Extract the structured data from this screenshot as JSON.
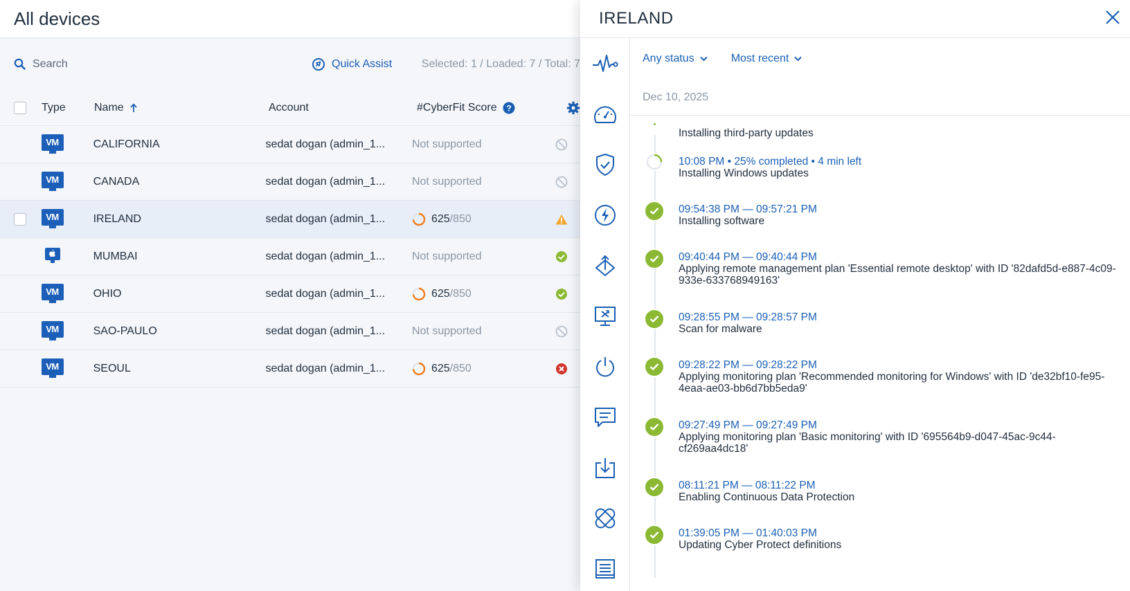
{
  "list": {
    "title": "All devices",
    "search_placeholder": "Search",
    "quick_assist": "Quick Assist",
    "counts": "Selected: 1 / Loaded: 7 / Total: 7",
    "columns": {
      "type": "Type",
      "name": "Name",
      "account": "Account",
      "cyberfit": "#CyberFit Score"
    },
    "rows": [
      {
        "name": "CALIFORNIA",
        "type": "VM",
        "account": "sedat dogan (admin_1...",
        "score": "Not supported",
        "score_max": "",
        "status": "not-protected"
      },
      {
        "name": "CANADA",
        "type": "VM",
        "account": "sedat dogan (admin_1...",
        "score": "Not supported",
        "score_max": "",
        "status": "not-protected"
      },
      {
        "name": "IRELAND",
        "type": "VM",
        "account": "sedat dogan (admin_1...",
        "score": "625",
        "score_max": "/850",
        "status": "warning"
      },
      {
        "name": "MUMBAI",
        "type": "Mac",
        "account": "sedat dogan (admin_1...",
        "score": "Not supported",
        "score_max": "",
        "status": "ok"
      },
      {
        "name": "OHIO",
        "type": "VM",
        "account": "sedat dogan (admin_1...",
        "score": "625",
        "score_max": "/850",
        "status": "ok"
      },
      {
        "name": "SAO-PAULO",
        "type": "VM",
        "account": "sedat dogan (admin_1...",
        "score": "Not supported",
        "score_max": "",
        "status": "not-protected"
      },
      {
        "name": "SEOUL",
        "type": "VM",
        "account": "sedat dogan (admin_1...",
        "score": "625",
        "score_max": "/850",
        "status": "error"
      }
    ],
    "vm_label": "VM"
  },
  "panel": {
    "title": "IRELAND",
    "filters": {
      "status": "Any status",
      "sort": "Most recent"
    },
    "date": "Dec 10, 2025",
    "first_item": "Installing third-party updates",
    "activities": [
      {
        "time": "10:08 PM • 25% completed • 4 min left",
        "desc": "Installing Windows updates",
        "state": "progress",
        "progress_pct": 25
      },
      {
        "time": "09:54:38 PM — 09:57:21 PM",
        "desc": "Installing software",
        "state": "done"
      },
      {
        "time": "09:40:44 PM — 09:40:44 PM",
        "desc": "Applying remote management plan 'Essential remote desktop' with ID '82dafd5d-e887-4c09-933e-633768949163'",
        "state": "done"
      },
      {
        "time": "09:28:55 PM — 09:28:57 PM",
        "desc": "Scan for malware",
        "state": "done"
      },
      {
        "time": "09:28:22 PM — 09:28:22 PM",
        "desc": "Applying monitoring plan 'Recommended monitoring for Windows' with ID 'de32bf10-fe95-4eaa-ae03-bb6d7bb5eda9'",
        "state": "done"
      },
      {
        "time": "09:27:49 PM — 09:27:49 PM",
        "desc": "Applying monitoring plan 'Basic monitoring' with ID '695564b9-d047-45ac-9c44-cf269aa4dc18'",
        "state": "done"
      },
      {
        "time": "08:11:21 PM — 08:11:22 PM",
        "desc": "Enabling Continuous Data Protection",
        "state": "done"
      },
      {
        "time": "01:39:05 PM — 01:40:03 PM",
        "desc": "Updating Cyber Protect definitions",
        "state": "done"
      }
    ],
    "sidebar_icons": [
      "activity-icon",
      "dashboard-icon",
      "protection-icon",
      "quick-action-icon",
      "deploy-icon",
      "remote-desktop-icon",
      "power-icon",
      "chat-icon",
      "backup-icon",
      "patch-icon",
      "report-icon"
    ]
  },
  "colors": {
    "accent": "#1a5fb4",
    "success": "#8cb934",
    "warning": "#f0a830",
    "error": "#d0342c",
    "score_ring": "#f07d1f"
  }
}
